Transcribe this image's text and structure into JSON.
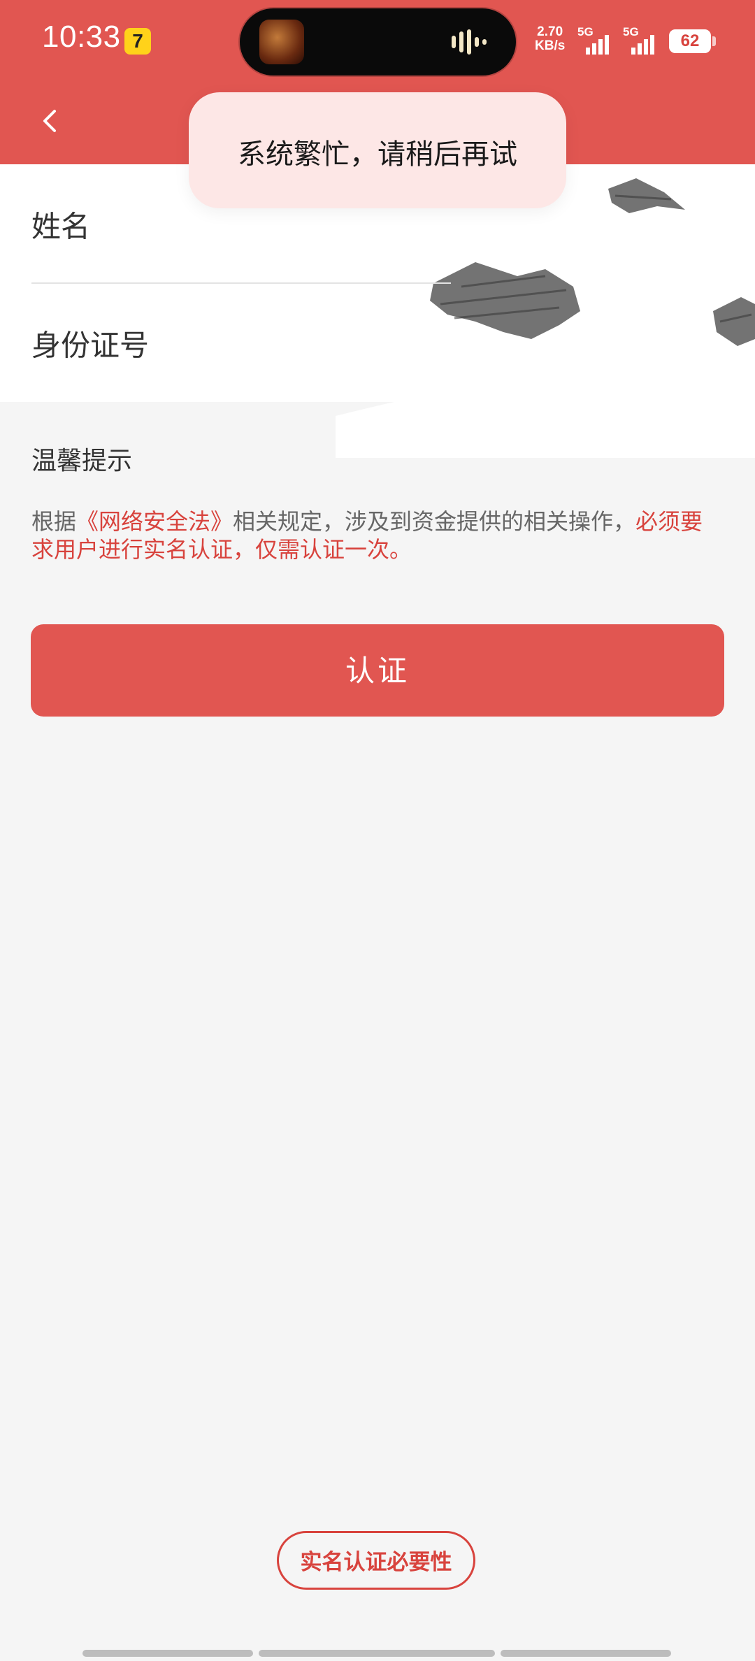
{
  "status_bar": {
    "time": "10:33",
    "app_badge": "7",
    "net_speed_value": "2.70",
    "net_speed_unit": "KB/s",
    "sim1_label": "5G",
    "sim2_label": "5G",
    "battery": "62"
  },
  "toast": {
    "message": "系统繁忙，请稍后再试"
  },
  "form": {
    "name_label": "姓名",
    "id_label": "身份证号"
  },
  "tips": {
    "title": "温馨提示",
    "text_prefix": "根据",
    "law_name": "《网络安全法》",
    "text_middle": "相关规定，涉及到资金提供的相关操作，",
    "text_emphasis": "必须要求用户进行实名认证，仅需认证一次。"
  },
  "actions": {
    "auth_button": "认证",
    "necessity_link": "实名认证必要性"
  },
  "colors": {
    "brand_red": "#e15651",
    "accent_red": "#d8433d",
    "toast_bg": "#fde7e6",
    "page_bg": "#f5f5f5"
  }
}
